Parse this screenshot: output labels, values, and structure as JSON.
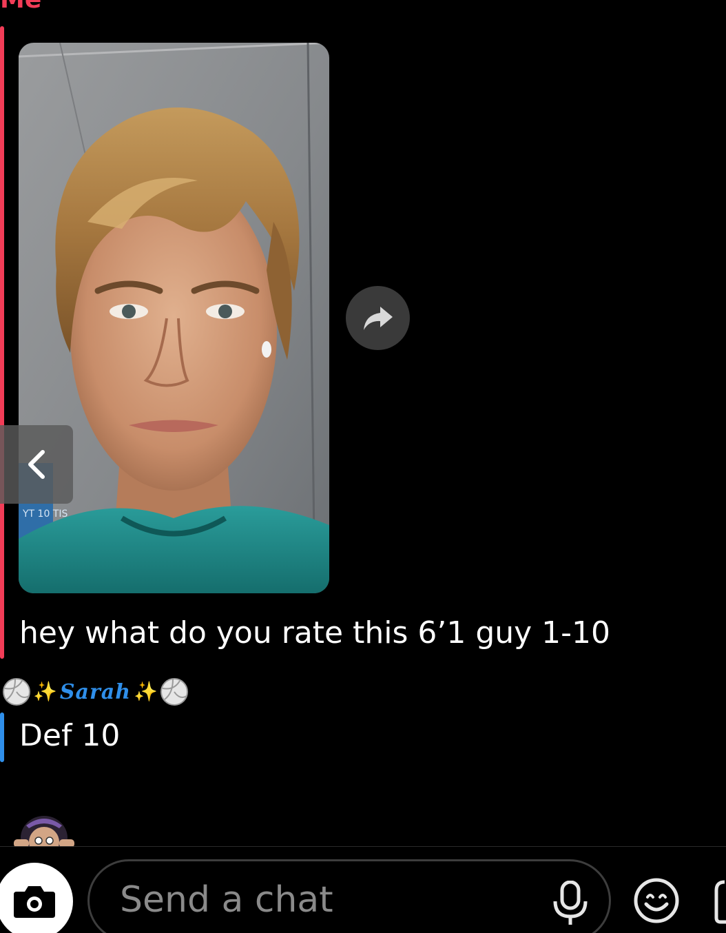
{
  "chat": {
    "me_label": "Me",
    "me_message": "hey what do you rate this 6’1 guy 1-10",
    "friend_name": "Sarah",
    "friend_message": "Def 10"
  },
  "composer": {
    "placeholder": "Send a chat"
  },
  "colors": {
    "me_accent": "#f23c57",
    "friend_accent": "#2f8fea",
    "background": "#000000"
  },
  "icons": {
    "share": "share-arrow-icon",
    "back": "chevron-left-icon",
    "camera": "camera-icon",
    "mic": "microphone-icon",
    "emoji": "smiley-icon",
    "sticker": "sticker-icon",
    "volleyball": "volleyball-icon",
    "sparkles": "sparkles-icon"
  },
  "photo": {
    "background_sign_text": "YT 10 TIS"
  }
}
